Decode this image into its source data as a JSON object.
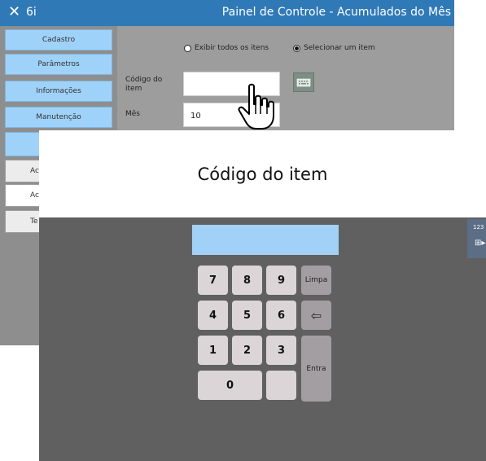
{
  "titlebar": {
    "close_glyph": "✕",
    "app_label": "6i",
    "title": "Painel de Controle - Acumulados do Mês"
  },
  "sidebar": {
    "items": [
      {
        "label": "Cadastro"
      },
      {
        "label": "Parâmetros"
      },
      {
        "label": "Informações"
      },
      {
        "label": "Manutenção"
      }
    ],
    "subitems": [
      {
        "label": "Acu"
      },
      {
        "label": "Acu"
      },
      {
        "label": "Te"
      }
    ]
  },
  "main": {
    "radio_all": "Exibir todos os itens",
    "radio_select": "Selecionar um item",
    "codigo_label": "Código do item",
    "codigo_value": "",
    "mes_label": "Mês",
    "mes_value": "10"
  },
  "keypad": {
    "title": "Código do item",
    "display_value": "",
    "keys": {
      "k7": "7",
      "k8": "8",
      "k9": "9",
      "k4": "4",
      "k5": "5",
      "k6": "6",
      "k1": "1",
      "k2": "2",
      "k3": "3",
      "k0": "0"
    },
    "limpa": "Limpa",
    "entra": "Entra",
    "backspace_glyph": "⇦"
  },
  "side_tab": {
    "label": "123",
    "glyph": "⊞▸"
  },
  "colors": {
    "titlebar": "#2f79b7",
    "sidebar_button": "#9fd2f8",
    "panel_gray": "#9d9d9d",
    "keypad_bg": "#606060",
    "key": "#dbd5d8",
    "key_fn": "#a39ea1",
    "display": "#a2d1f7"
  }
}
